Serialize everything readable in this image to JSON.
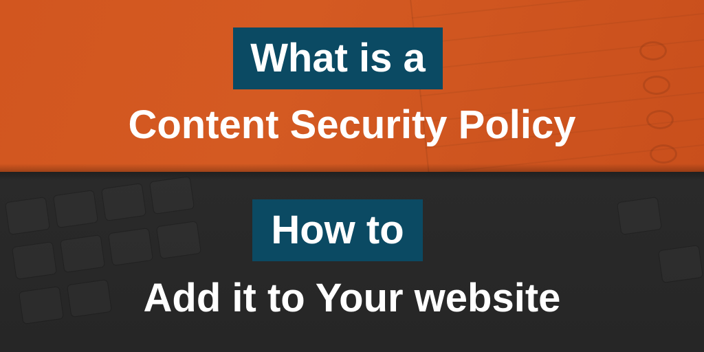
{
  "banner": {
    "line1": "What is a",
    "line2": "Content Security Policy",
    "line3": "How to",
    "line4": "Add it to Your website"
  },
  "colors": {
    "top_background": "#d2561f",
    "bottom_background": "#282828",
    "highlight_box": "#0b4a63",
    "text": "#ffffff"
  },
  "decorations": {
    "top_right": "spiral-notebook",
    "bottom_left": "keyboard"
  }
}
